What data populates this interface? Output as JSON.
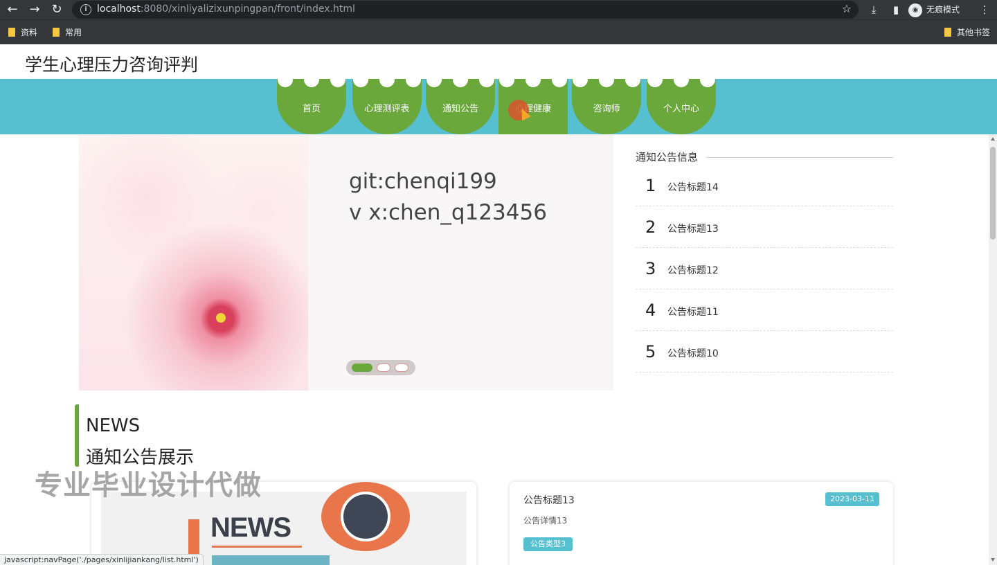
{
  "browser": {
    "url_host": "localhost",
    "url_rest": ":8080/xinliyalizixunpingpan/front/index.html",
    "incognito_label": "无痕模式",
    "bookmarks": [
      "资料",
      "常用"
    ],
    "other_bookmarks": "其他书签"
  },
  "site": {
    "title": "学生心理压力咨询评判"
  },
  "nav": {
    "items": [
      "首页",
      "心理测评表",
      "通知公告",
      "心理健康",
      "咨询师",
      "个人中心"
    ],
    "active_index": 3
  },
  "banner": {
    "line1": "git:chenqi199",
    "line2": "v x:chen_q123456"
  },
  "notices": {
    "heading": "通知公告信息",
    "items": [
      {
        "num": "1",
        "title": "公告标题14"
      },
      {
        "num": "2",
        "title": "公告标题13"
      },
      {
        "num": "3",
        "title": "公告标题12"
      },
      {
        "num": "4",
        "title": "公告标题11"
      },
      {
        "num": "5",
        "title": "公告标题10"
      }
    ]
  },
  "section": {
    "en": "NEWS",
    "cn": "通知公告展示"
  },
  "watermark": "专业毕业设计代做",
  "news_card": {
    "image_word": "NEWS",
    "title": "公告标题13",
    "date": "2023-03-11",
    "detail": "公告详情13",
    "tag": "公告类型3"
  },
  "status_bar": "javascript:navPage('./pages/xinlijiankang/list.html')",
  "colors": {
    "nav_bg": "#56bfd0",
    "nav_item": "#6aa83b",
    "accent_green": "#6aa83b",
    "badge": "#56bfd0"
  }
}
